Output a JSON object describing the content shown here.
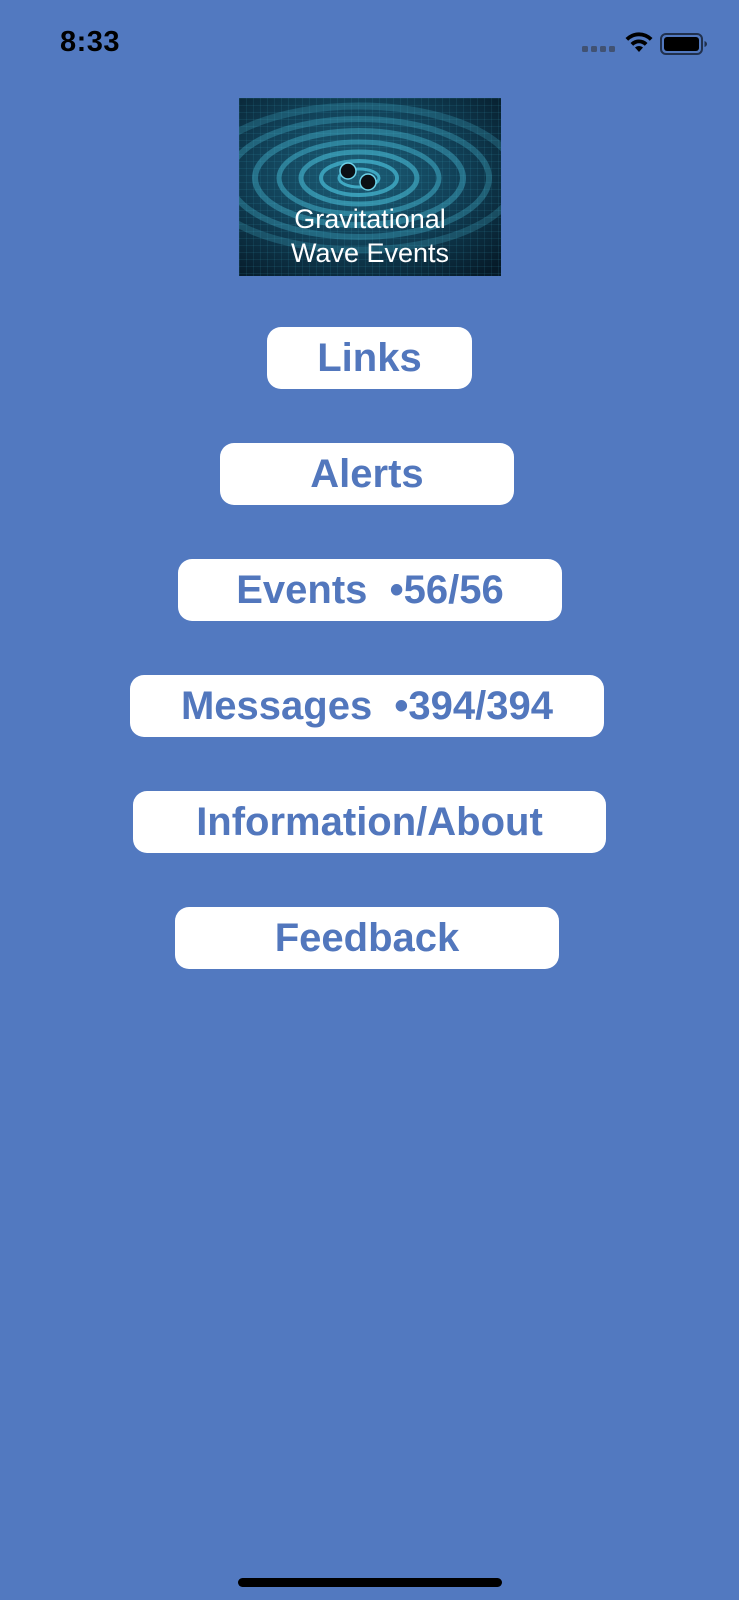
{
  "status_bar": {
    "time": "8:33"
  },
  "logo": {
    "line1": "Gravitational",
    "line2": "Wave Events"
  },
  "menu": {
    "links": "Links",
    "alerts": "Alerts",
    "events": "Events  •56/56",
    "messages": "Messages  •394/394",
    "information": "Information/About",
    "feedback": "Feedback"
  },
  "colors": {
    "background": "#5279c0",
    "button_background": "#ffffff",
    "button_text": "#5277bd"
  }
}
